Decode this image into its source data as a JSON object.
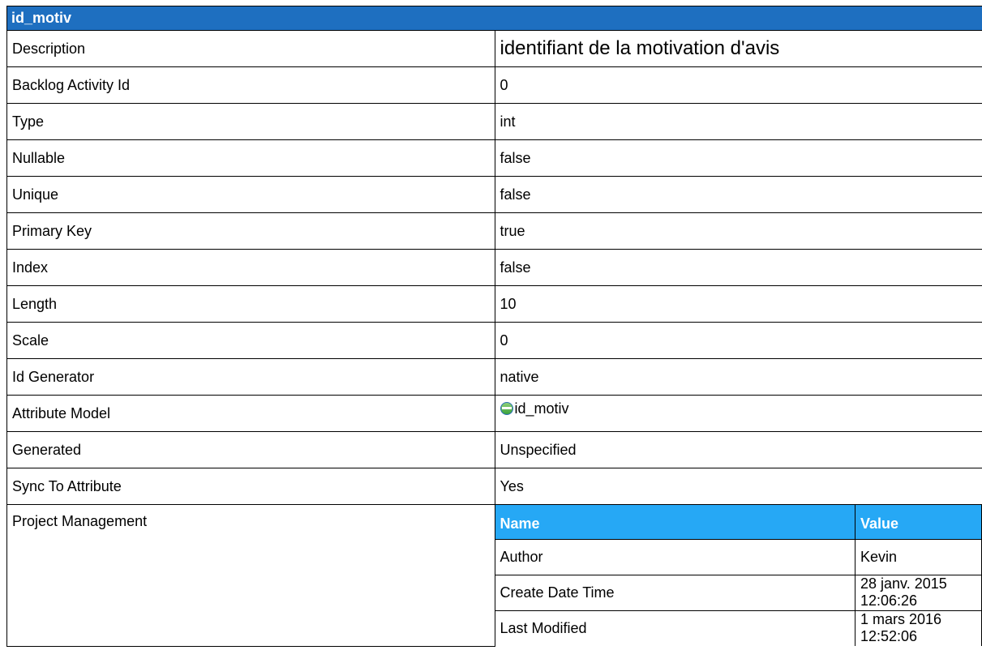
{
  "header": {
    "title": "id_motiv"
  },
  "properties": [
    {
      "key": "Description",
      "value": "identifiant de la motivation d'avis"
    },
    {
      "key": "Backlog Activity Id",
      "value": "0"
    },
    {
      "key": "Type",
      "value": "int"
    },
    {
      "key": "Nullable",
      "value": "false"
    },
    {
      "key": "Unique",
      "value": "false"
    },
    {
      "key": "Primary Key",
      "value": "true"
    },
    {
      "key": "Index",
      "value": "false"
    },
    {
      "key": "Length",
      "value": "10"
    },
    {
      "key": "Scale",
      "value": "0"
    },
    {
      "key": "Id Generator",
      "value": "native"
    },
    {
      "key": "Attribute Model",
      "value": "id_motiv",
      "icon": "attribute-icon"
    },
    {
      "key": "Generated",
      "value": "Unspecified"
    },
    {
      "key": "Sync To Attribute",
      "value": "Yes"
    }
  ],
  "project_management": {
    "label": "Project Management",
    "headers": {
      "name": "Name",
      "value": "Value"
    },
    "rows": [
      {
        "name": "Author",
        "value": "Kevin"
      },
      {
        "name": "Create Date Time",
        "value": "28 janv. 2015 12:06:26"
      },
      {
        "name": "Last Modified",
        "value": "1 mars 2016 12:52:06"
      }
    ]
  },
  "colors": {
    "header_bg": "#1e6fc0",
    "subheader_bg": "#26a8f5"
  }
}
